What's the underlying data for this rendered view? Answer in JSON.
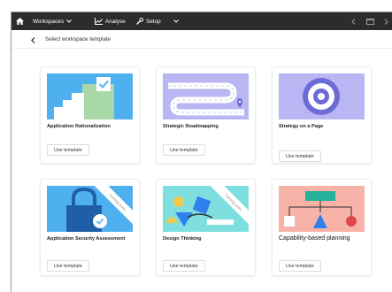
{
  "nav": {
    "workspaces": "Workspaces",
    "analyse": "Analyse",
    "setup": "Setup"
  },
  "subheader": {
    "title": "Select workspace template"
  },
  "cards": [
    {
      "title": "Application Rationalization",
      "button": "Use template"
    },
    {
      "title": "Strategic Roadmapping",
      "button": "Use template"
    },
    {
      "title": "Strategy on a Page",
      "button": "Use template"
    },
    {
      "title": "Application Security Assessment",
      "button": "Use template",
      "ribbon": "Coming soon"
    },
    {
      "title": "Design Thinking",
      "button": "Use template",
      "ribbon": "Coming soon"
    },
    {
      "title": "Capability-based planning",
      "button": "Use template"
    }
  ],
  "colors": {
    "topbar": "#2c2c2e",
    "blue": "#4fb0f0",
    "purple": "#b9b6f3",
    "teal": "#7fdfdf",
    "salmon": "#f8b3a8",
    "green": "#a8d8a8"
  }
}
